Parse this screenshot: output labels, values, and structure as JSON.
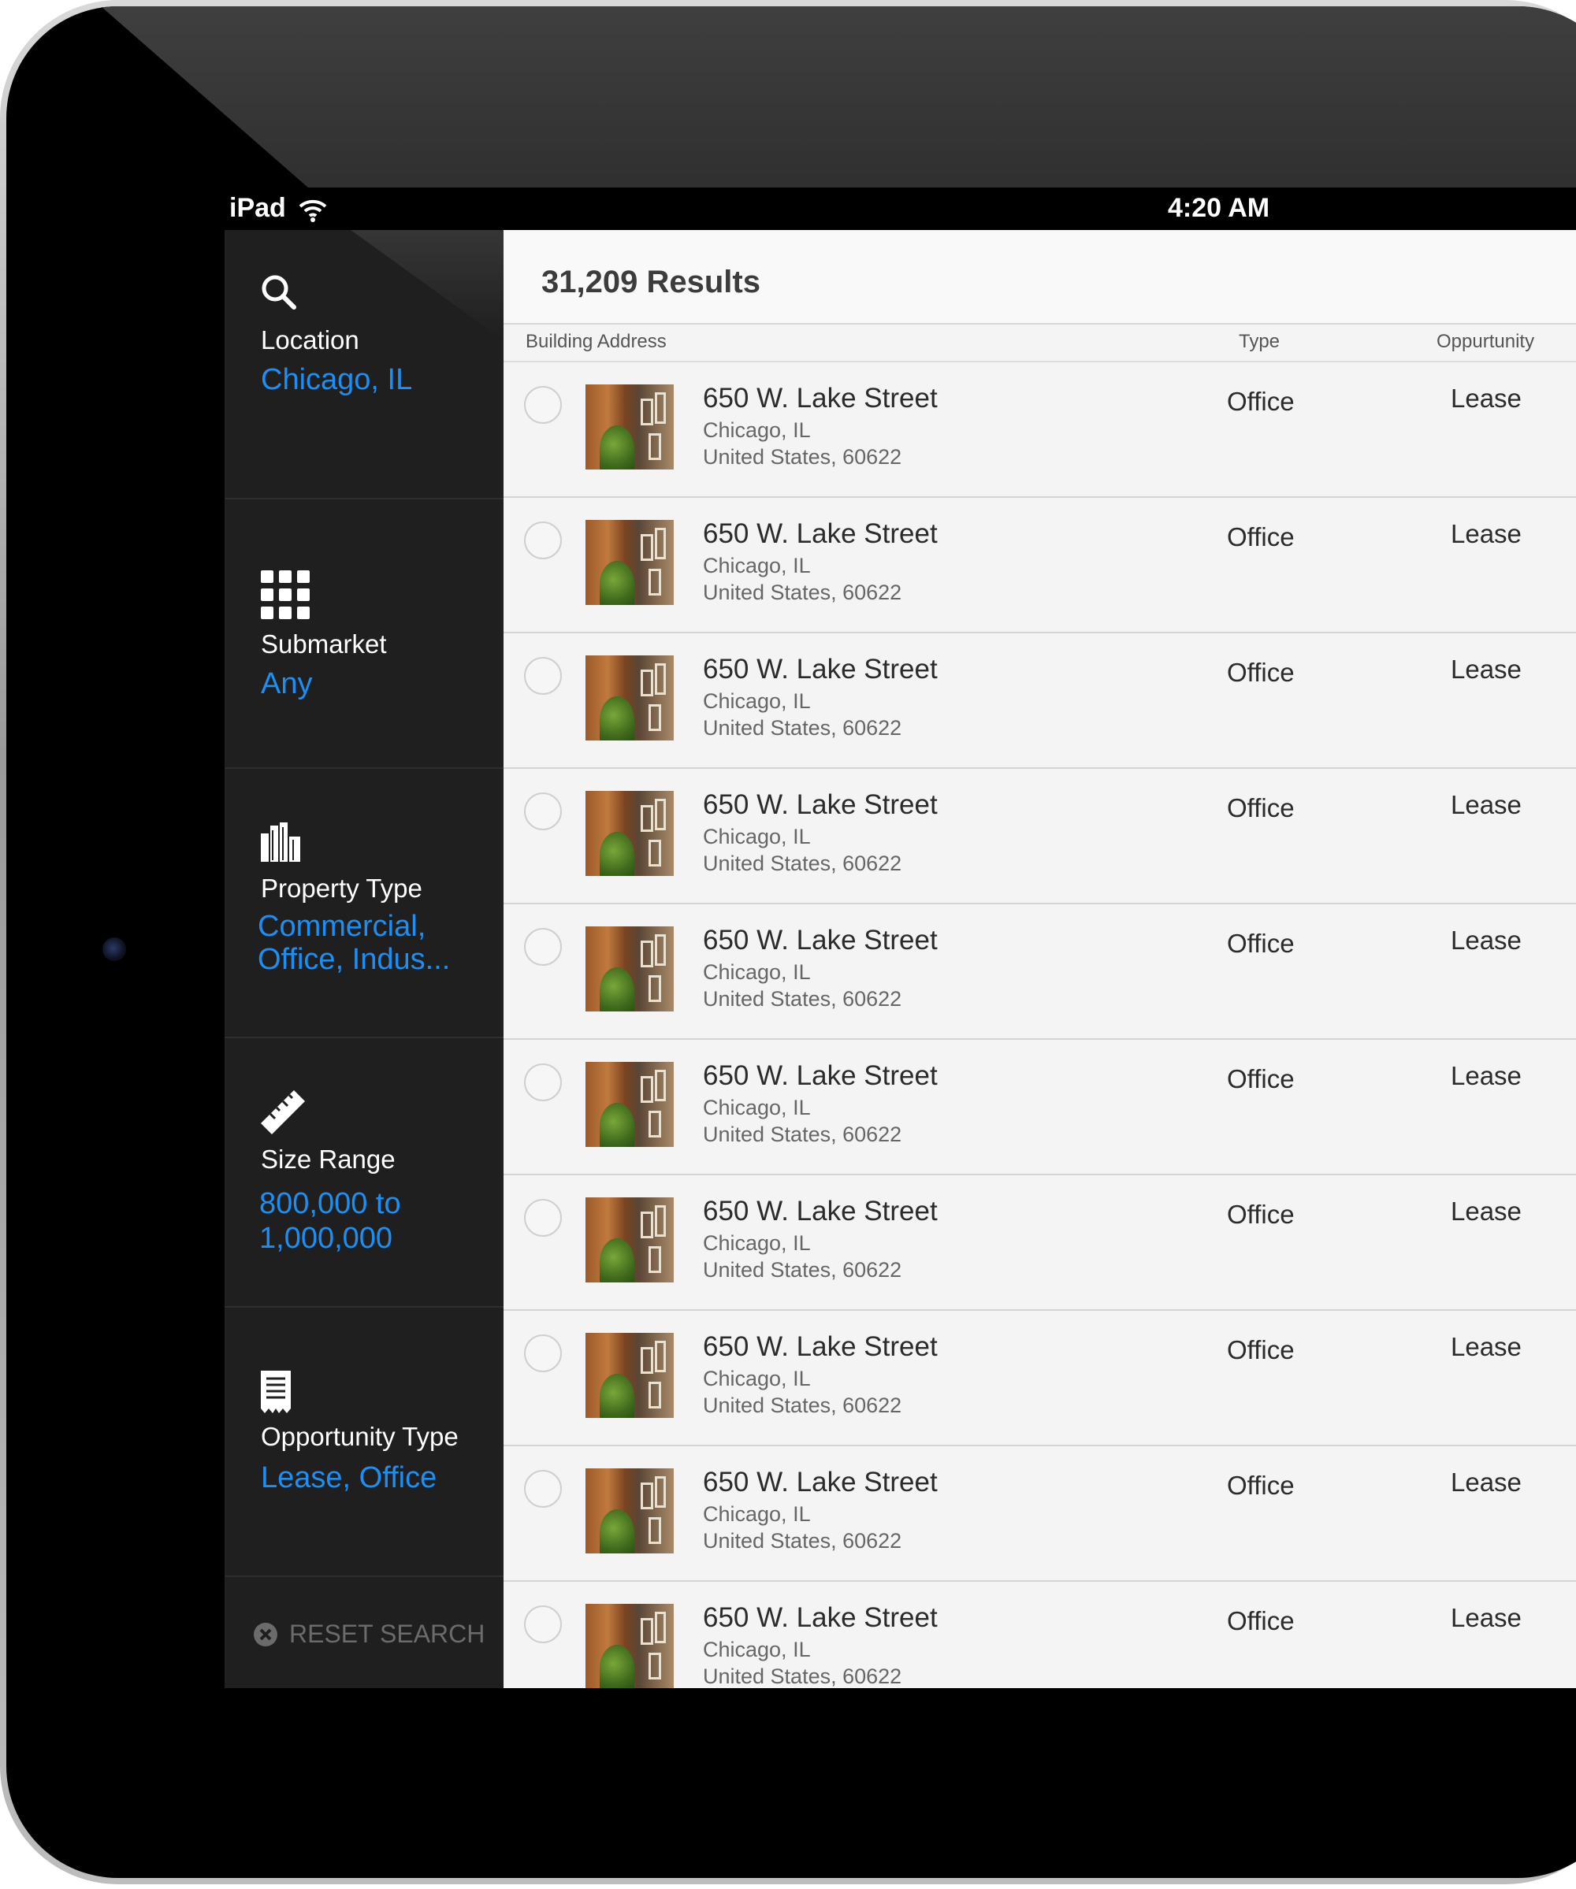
{
  "status_bar": {
    "carrier": "iPad",
    "wifi_icon": "wifi-icon",
    "time": "4:20 AM"
  },
  "sidebar": {
    "filters": [
      {
        "icon": "search-icon",
        "label": "Location",
        "value": "Chicago, IL"
      },
      {
        "icon": "grid-icon",
        "label": "Submarket",
        "value": "Any"
      },
      {
        "icon": "buildings-icon",
        "label": "Property Type",
        "value_lines": [
          "Commercial,",
          "Office, Indus..."
        ]
      },
      {
        "icon": "ruler-icon",
        "label": "Size Range",
        "value_lines": [
          "800,000 to",
          "1,000,000"
        ]
      },
      {
        "icon": "receipt-icon",
        "label": "Opportunity Type",
        "value": "Lease, Office"
      }
    ],
    "reset": {
      "icon": "clear-icon",
      "label": "RESET SEARCH"
    }
  },
  "results": {
    "count_label": "31,209 Results",
    "columns": {
      "address": "Building Address",
      "type": "Type",
      "opportunity": "Oppurtunity"
    },
    "rows": [
      {
        "street": "650 W. Lake Street",
        "city": "Chicago, IL",
        "country_zip": "United States, 60622",
        "type": "Office",
        "opportunity": "Lease"
      },
      {
        "street": "650 W. Lake Street",
        "city": "Chicago, IL",
        "country_zip": "United States, 60622",
        "type": "Office",
        "opportunity": "Lease"
      },
      {
        "street": "650 W. Lake Street",
        "city": "Chicago, IL",
        "country_zip": "United States, 60622",
        "type": "Office",
        "opportunity": "Lease"
      },
      {
        "street": "650 W. Lake Street",
        "city": "Chicago, IL",
        "country_zip": "United States, 60622",
        "type": "Office",
        "opportunity": "Lease"
      },
      {
        "street": "650 W. Lake Street",
        "city": "Chicago, IL",
        "country_zip": "United States, 60622",
        "type": "Office",
        "opportunity": "Lease"
      },
      {
        "street": "650 W. Lake Street",
        "city": "Chicago, IL",
        "country_zip": "United States, 60622",
        "type": "Office",
        "opportunity": "Lease"
      },
      {
        "street": "650 W. Lake Street",
        "city": "Chicago, IL",
        "country_zip": "United States, 60622",
        "type": "Office",
        "opportunity": "Lease"
      },
      {
        "street": "650 W. Lake Street",
        "city": "Chicago, IL",
        "country_zip": "United States, 60622",
        "type": "Office",
        "opportunity": "Lease"
      },
      {
        "street": "650 W. Lake Street",
        "city": "Chicago, IL",
        "country_zip": "United States, 60622",
        "type": "Office",
        "opportunity": "Lease"
      },
      {
        "street": "650 W. Lake Street",
        "city": "Chicago, IL",
        "country_zip": "United States, 60622",
        "type": "Office",
        "opportunity": "Lease"
      }
    ]
  },
  "colors": {
    "accent": "#1e8ff2",
    "sidebar_bg": "#1f1f1f",
    "list_bg": "#f4f4f4"
  }
}
